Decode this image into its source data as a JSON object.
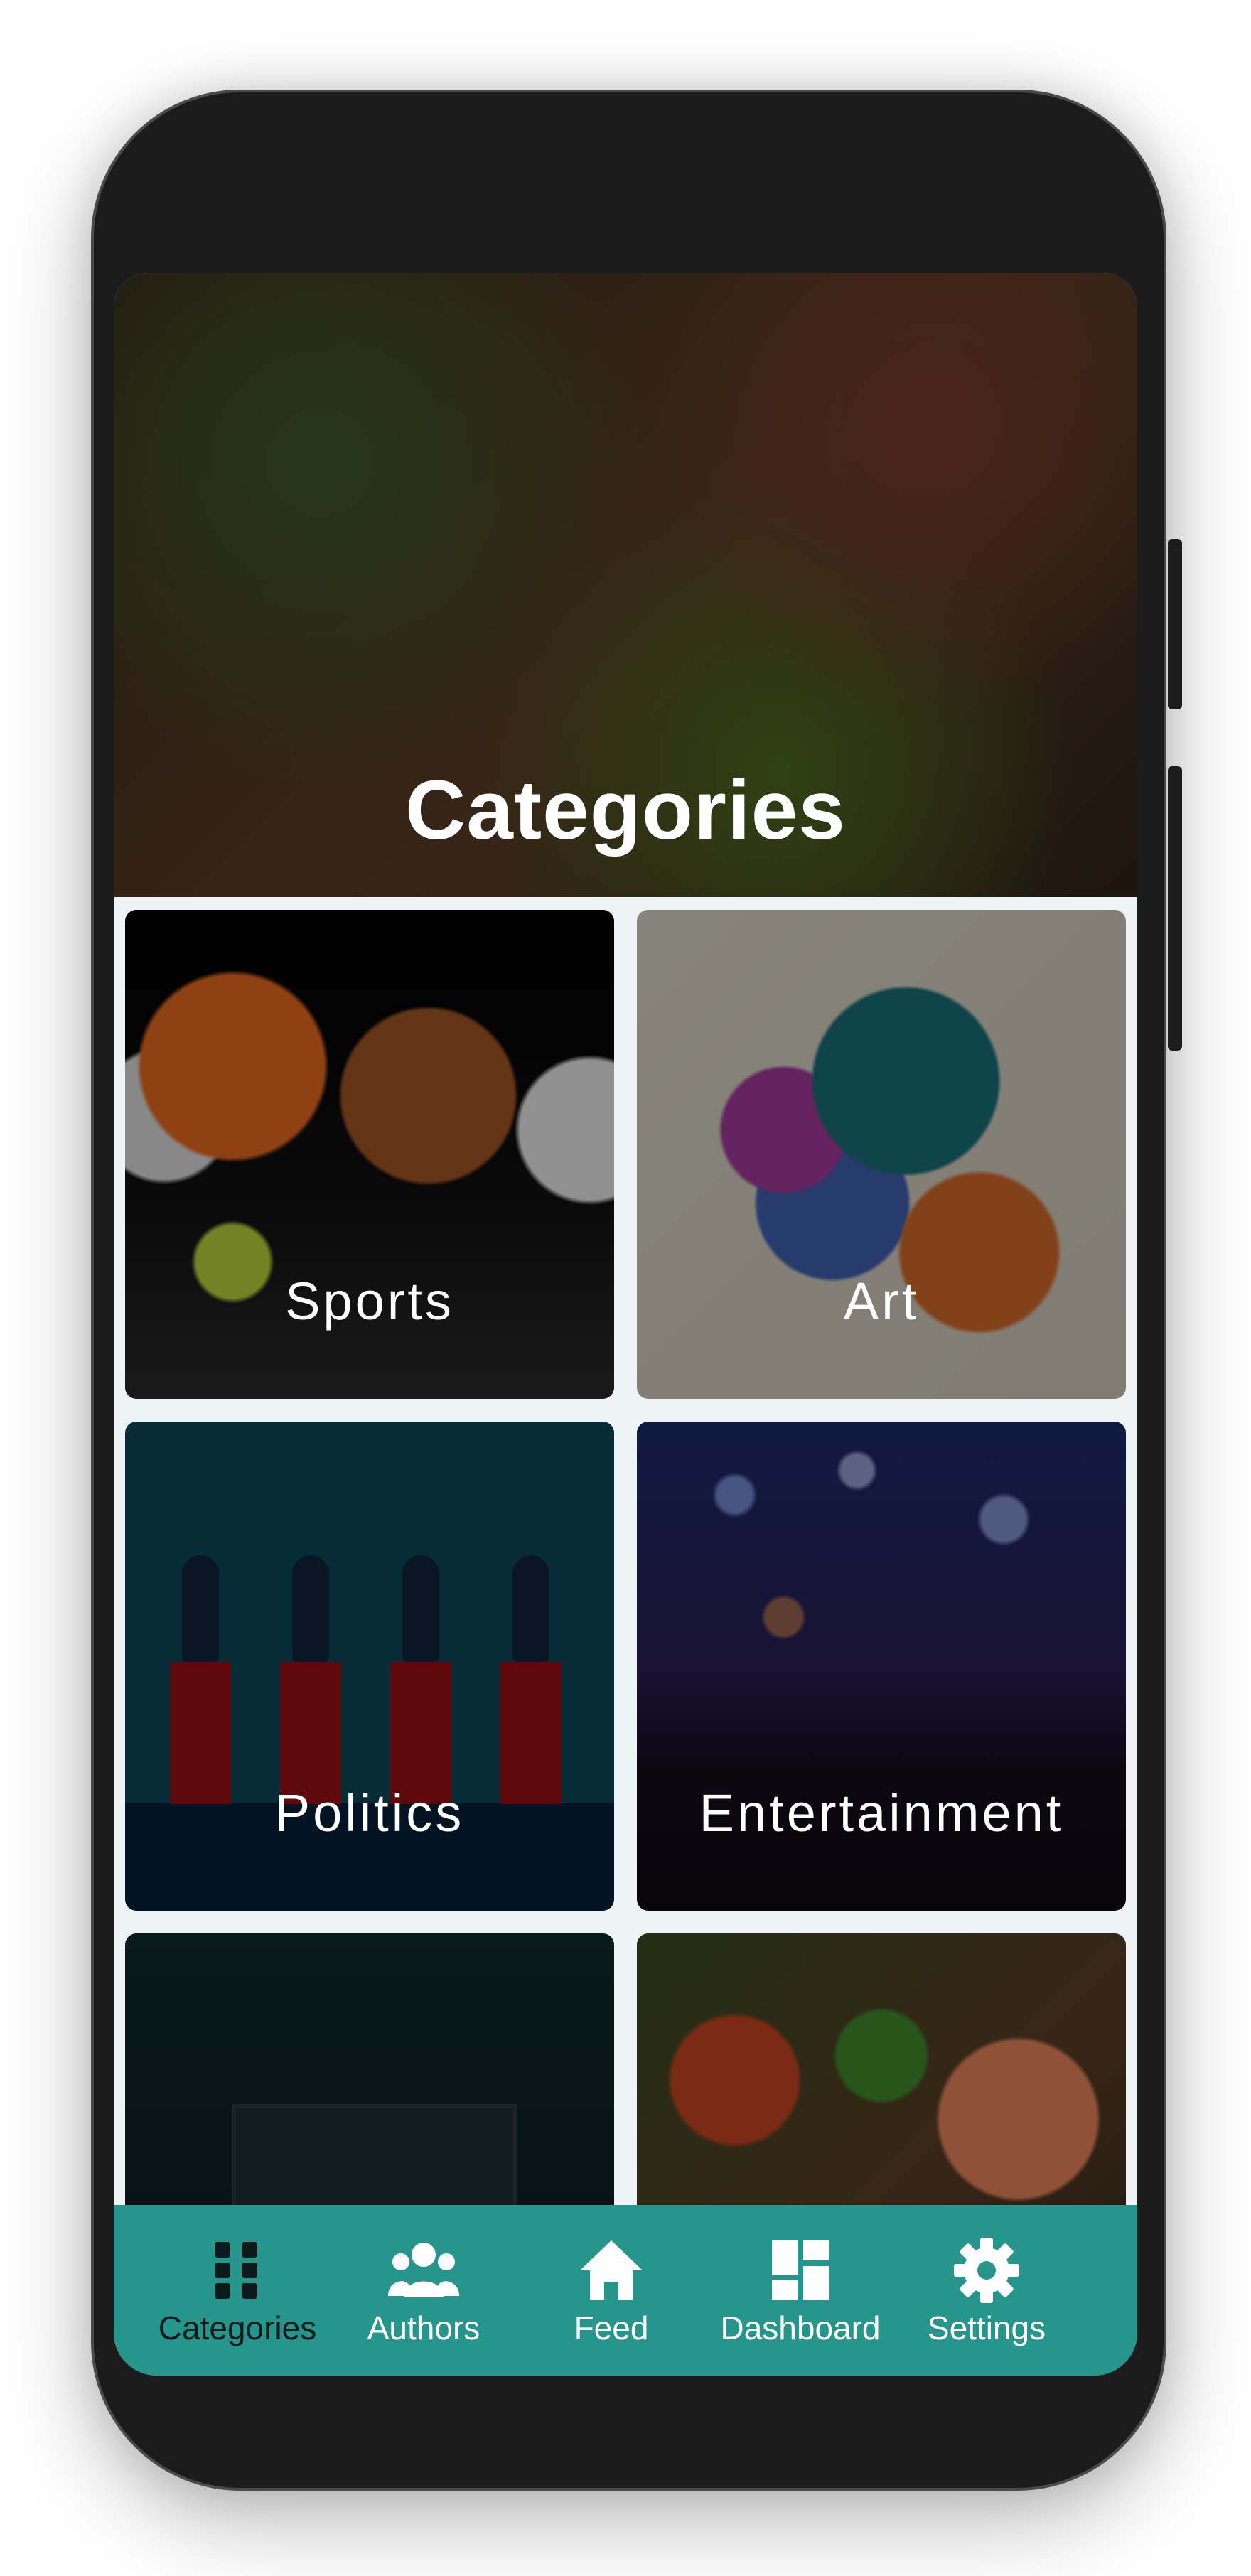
{
  "hero": {
    "title": "Categories"
  },
  "categories": [
    {
      "label": "Sports"
    },
    {
      "label": "Art"
    },
    {
      "label": "Politics"
    },
    {
      "label": "Entertainment"
    },
    {
      "label": ""
    },
    {
      "label": ""
    }
  ],
  "nav": {
    "items": [
      {
        "label": "Categories",
        "icon": "grid-icon",
        "active": true
      },
      {
        "label": "Authors",
        "icon": "people-icon",
        "active": false
      },
      {
        "label": "Feed",
        "icon": "home-icon",
        "active": false
      },
      {
        "label": "Dashboard",
        "icon": "dashboard-icon",
        "active": false
      },
      {
        "label": "Settings",
        "icon": "gear-icon",
        "active": false
      }
    ]
  },
  "colors": {
    "accent": "#26958b",
    "active_nav": "#0b1a1a"
  }
}
